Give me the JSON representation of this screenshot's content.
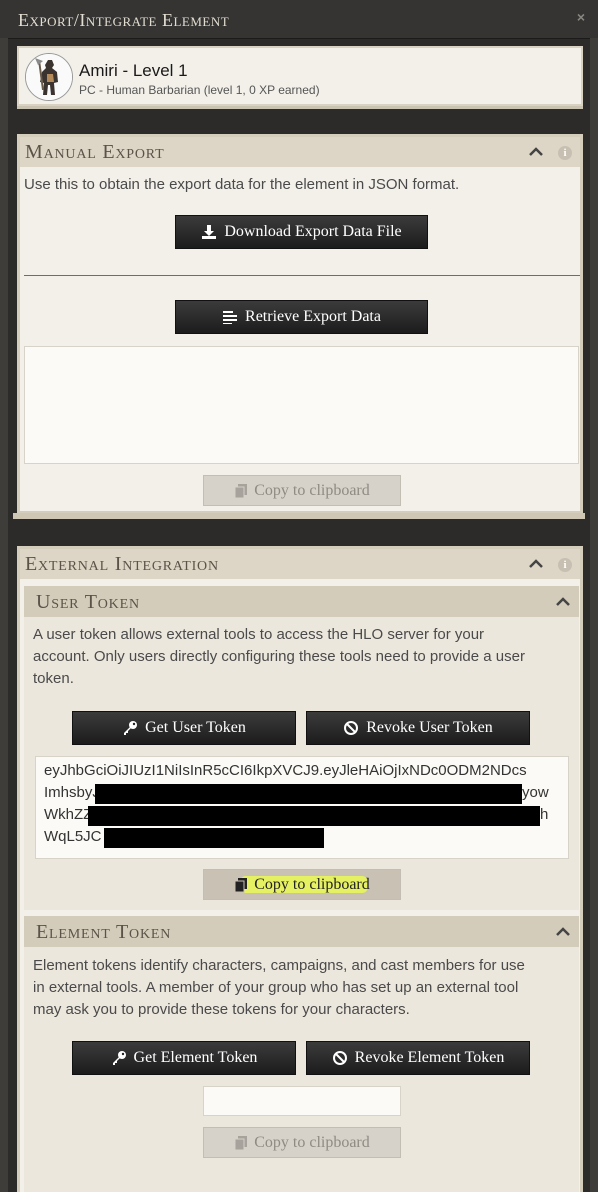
{
  "window": {
    "title": "Export/Integrate Element",
    "close_label": "×"
  },
  "character": {
    "name": "Amiri - Level 1",
    "subtitle": "PC - Human Barbarian (level 1, 0 XP earned)"
  },
  "manual_export": {
    "title": "Manual Export",
    "description": "Use this to obtain the export data for the element in JSON format.",
    "download_label": "Download Export Data File",
    "retrieve_label": "Retrieve Export Data",
    "export_text": "",
    "copy_label": "Copy to clipboard"
  },
  "external_integration": {
    "title": "External Integration",
    "user_token": {
      "title": "User Token",
      "description_lines": [
        "A user token allows external tools to access the HLO server for your",
        "account. Only users directly configuring these tools need to provide a user",
        "token."
      ],
      "get_label": "Get User Token",
      "revoke_label": "Revoke User Token",
      "token_lines": [
        "eyJhbGciOiJIUzI1NiIsInR5cCI6IkpXVCJ9.eyJleHAiOjIxNDc0ODM2NDcs",
        "ImhsbyJ",
        "yow",
        "WkhZZ",
        "h",
        "WqL5JC"
      ],
      "copy_label": "Copy to clipboard"
    },
    "element_token": {
      "title": "Element Token",
      "description_lines": [
        "Element tokens identify characters, campaigns, and cast members for use",
        "in external tools. A member of your group who has set up an external tool",
        "may ask you to provide these tokens for your characters."
      ],
      "get_label": "Get Element Token",
      "revoke_label": "Revoke Element Token",
      "token_value": "",
      "copy_label": "Copy to clipboard"
    }
  },
  "icons": {
    "download": "download-icon",
    "list": "list-icon",
    "copy": "copy-icon",
    "key": "key-icon",
    "ban": "ban-icon",
    "chevron": "chevron-up-icon",
    "info": "info-icon"
  }
}
